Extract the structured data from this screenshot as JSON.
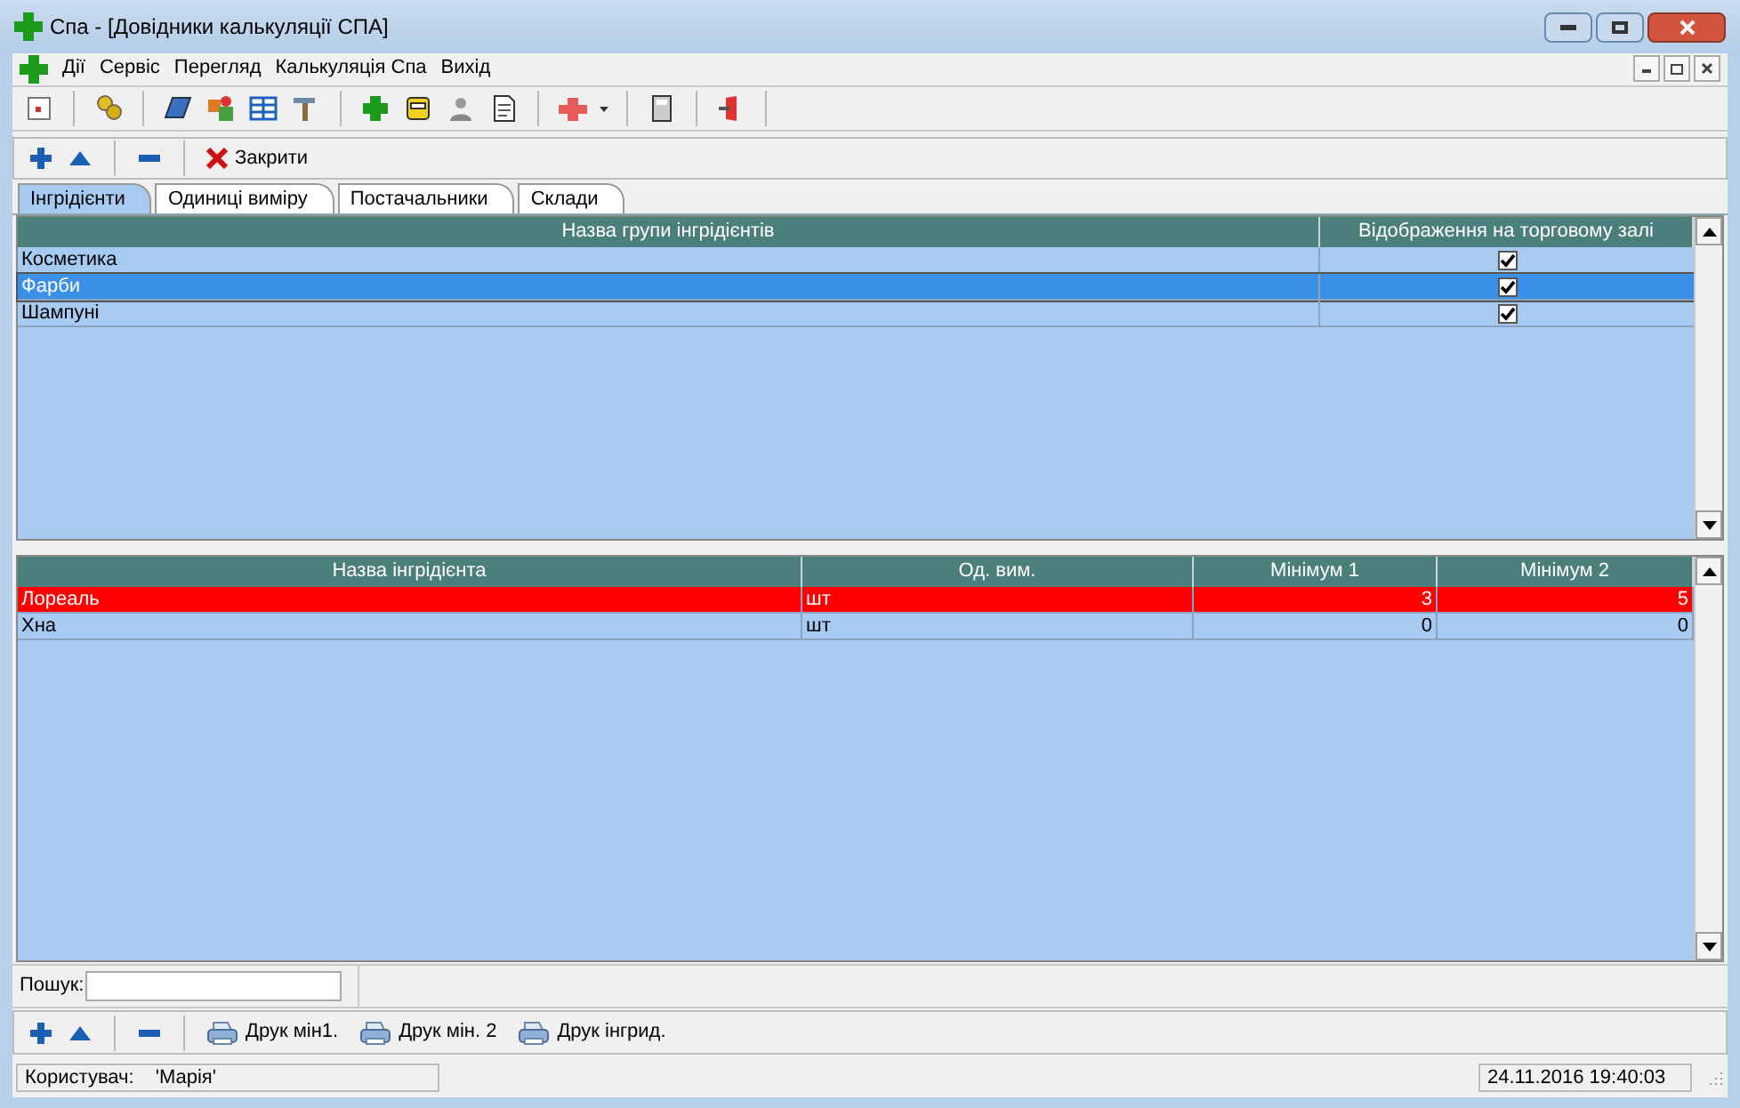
{
  "window": {
    "title": "Спа - [Довідники калькуляції СПА]"
  },
  "menu": [
    "Дії",
    "Сервіс",
    "Перегляд",
    "Калькуляція Спа",
    "Вихід"
  ],
  "action_bar": {
    "close_label": "Закрити"
  },
  "tabs": [
    {
      "label": "Інгрідієнти",
      "selected": true
    },
    {
      "label": "Одиниці виміру",
      "selected": false
    },
    {
      "label": "Постачальники",
      "selected": false
    },
    {
      "label": "Склади",
      "selected": false
    }
  ],
  "groups_table": {
    "columns": [
      "Назва групи інгрідієнтів",
      "Відображення на торговому залі"
    ],
    "rows": [
      {
        "name": "Косметика",
        "checked": true,
        "selected": false
      },
      {
        "name": "Фарби",
        "checked": true,
        "selected": true
      },
      {
        "name": "Шампуні",
        "checked": true,
        "selected": false
      }
    ]
  },
  "ingredients_table": {
    "columns": [
      "Назва інгрідієнта",
      "Од. вим.",
      "Мінімум 1",
      "Мінімум 2"
    ],
    "rows": [
      {
        "name": "Лореаль",
        "unit": "шт",
        "min1": "3",
        "min2": "5",
        "flagged": true
      },
      {
        "name": "Хна",
        "unit": "шт",
        "min1": "0",
        "min2": "0",
        "flagged": false
      }
    ]
  },
  "search": {
    "label": "Пошук:"
  },
  "bottom_toolbar": [
    "Друк мін1.",
    "Друк мін. 2",
    "Друк інгрид."
  ],
  "status_bar": {
    "user_label": "Користувач:",
    "user": "'Марія'",
    "datetime": "24.11.2016 19:40:03"
  }
}
